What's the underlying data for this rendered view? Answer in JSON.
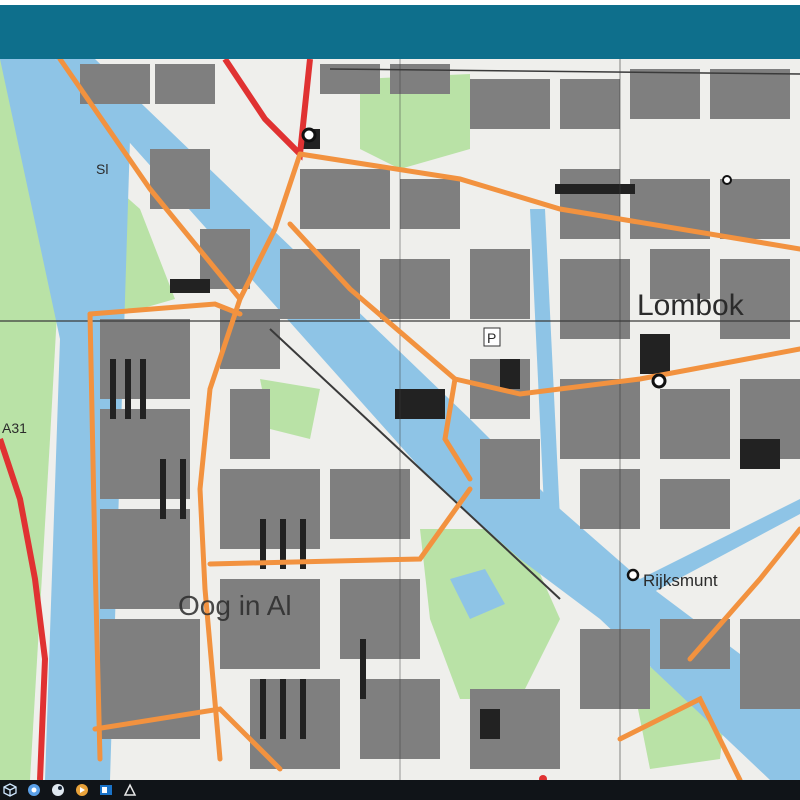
{
  "window": {
    "title_bar_color": "#0e6f8c"
  },
  "map": {
    "labels": {
      "district_east": "Lombok",
      "district_south": "Oog in Al",
      "landmark": "Rijksmunt",
      "parking": "P",
      "marker_nw": "Sl",
      "road_number": "A31"
    },
    "colors": {
      "water": "#8ec4e6",
      "land": "#efefec",
      "green": "#b9e2a6",
      "building": "#7f7f7f",
      "building_dark": "#222222",
      "main_road": "#f2923f",
      "highway": "#e03232",
      "grid_line": "#3a3a3a"
    }
  },
  "taskbar": {
    "icons": [
      "cube-icon",
      "chrome-icon",
      "steam-icon",
      "media-icon",
      "outlook-icon",
      "app-icon"
    ]
  }
}
